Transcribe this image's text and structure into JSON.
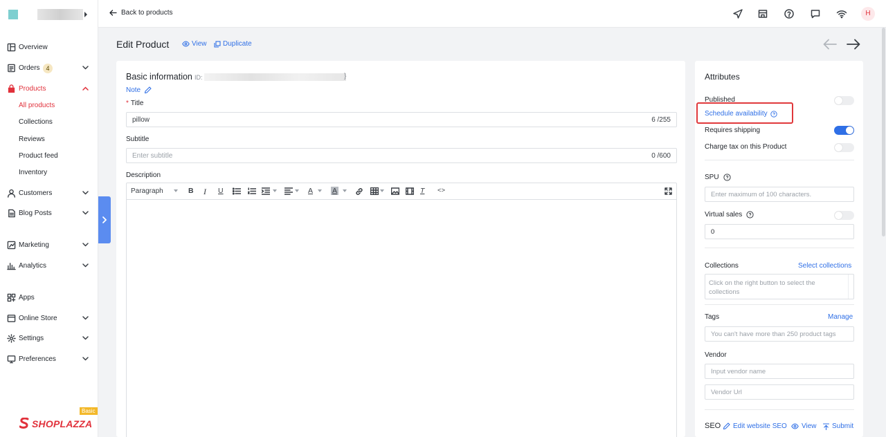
{
  "topbar": {
    "back_label": "Back to products",
    "avatar_initial": "H"
  },
  "sidebar": {
    "items": [
      {
        "label": "Overview"
      },
      {
        "label": "Orders",
        "badge": "4"
      },
      {
        "label": "Products"
      },
      {
        "label": "Customers"
      },
      {
        "label": "Blog Posts"
      },
      {
        "label": "Marketing"
      },
      {
        "label": "Analytics"
      },
      {
        "label": "Apps"
      },
      {
        "label": "Online Store"
      },
      {
        "label": "Settings"
      },
      {
        "label": "Preferences"
      }
    ],
    "product_subitems": [
      "All products",
      "Collections",
      "Reviews",
      "Product feed",
      "Inventory"
    ],
    "plan_badge": "Basic",
    "logo_text": "SHOPLAZZA"
  },
  "header": {
    "title": "Edit Product",
    "view_label": "View",
    "duplicate_label": "Duplicate"
  },
  "main": {
    "section_title": "Basic information",
    "id_label": "ID:",
    "id_suffix": "}",
    "note_label": "Note",
    "title_label": "Title",
    "title_required": "*",
    "title_value": "pillow",
    "title_count": "6 /255",
    "subtitle_label": "Subtitle",
    "subtitle_placeholder": "Enter subtitle",
    "subtitle_count": "0 /600",
    "description_label": "Description",
    "toolbar": {
      "paragraph": "Paragraph",
      "bold": "B",
      "italic": "I",
      "underline": "U",
      "font_color": "A",
      "bg_color": "A",
      "clear_format": "T",
      "code": "<>"
    }
  },
  "attributes": {
    "title": "Attributes",
    "published_label": "Published",
    "published": false,
    "schedule_label": "Schedule availability",
    "requires_shipping_label": "Requires shipping",
    "requires_shipping": true,
    "charge_tax_label": "Charge tax on this Product",
    "charge_tax": false,
    "spu_label": "SPU",
    "spu_placeholder": "Enter maximum of 100 characters.",
    "virtual_sales_label": "Virtual sales",
    "virtual_sales": false,
    "virtual_sales_value": "0",
    "collections_label": "Collections",
    "select_collections": "Select collections",
    "collections_placeholder": "Click on the right button to select the collections",
    "tags_label": "Tags",
    "tags_manage": "Manage",
    "tags_placeholder": "You can't have more than 250 product tags",
    "vendor_label": "Vendor",
    "vendor_name_placeholder": "Input vendor name",
    "vendor_url_placeholder": "Vendor Url",
    "seo_label": "SEO",
    "edit_seo": "Edit website SEO",
    "seo_view": "View",
    "seo_submit": "Submit"
  },
  "colors": {
    "accent": "#2f6fe6",
    "brand": "#e1313b",
    "highlight": "#e0383b"
  }
}
